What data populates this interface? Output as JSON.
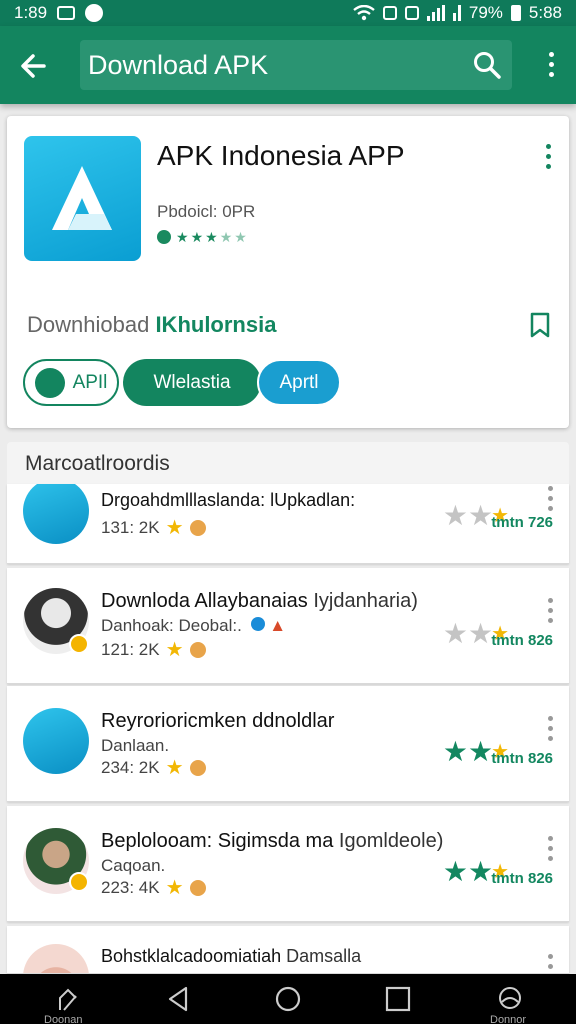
{
  "status": {
    "time": "1:89",
    "battery": "79%",
    "clock_right": "5:88"
  },
  "header": {
    "title": "Download APK"
  },
  "app": {
    "title": "APK Indonesia APP",
    "subtitle": "Pbdoicl: 0PR",
    "download_prefix": "Downhiobad",
    "download_accent": "IKhulornsia",
    "chips": [
      "APIl",
      "Wlelastia",
      "Aprtl"
    ],
    "colors": {
      "accent": "#13855f",
      "blue": "#1a9ed0"
    }
  },
  "section": {
    "title": "Marcoatlroordis"
  },
  "list": [
    {
      "title": "Drgoahdmlllaslanda: lUpkadlan:",
      "sub": "",
      "meta": "131: 2K",
      "score": "tmtn 726",
      "stars": "gray"
    },
    {
      "title": "Downloda Allaybanaias",
      "title_suffix": "Iyjdanharia)",
      "sub": "Danhoak: Deobal:.",
      "meta": "121: 2K",
      "score": "tmtn 826",
      "stars": "gray"
    },
    {
      "title": "Reyrorioricmken ddnoldlar",
      "sub": "Danlaan.",
      "meta": "234: 2K",
      "score": "tmtn 826",
      "stars": "green"
    },
    {
      "title": "Beplolooam: Sigimsda ma",
      "title_suffix": "Igomldeole)",
      "sub": "Caqoan.",
      "meta": "223: 4K",
      "score": "tmtn 826",
      "stars": "green"
    },
    {
      "title": "Bohstklalcadoomiatiah",
      "title_suffix": "Damsalla",
      "sub": "",
      "meta": "",
      "score": "",
      "stars": ""
    }
  ],
  "nav": {
    "left_label": "Doonan",
    "right_label": "Donnor"
  }
}
